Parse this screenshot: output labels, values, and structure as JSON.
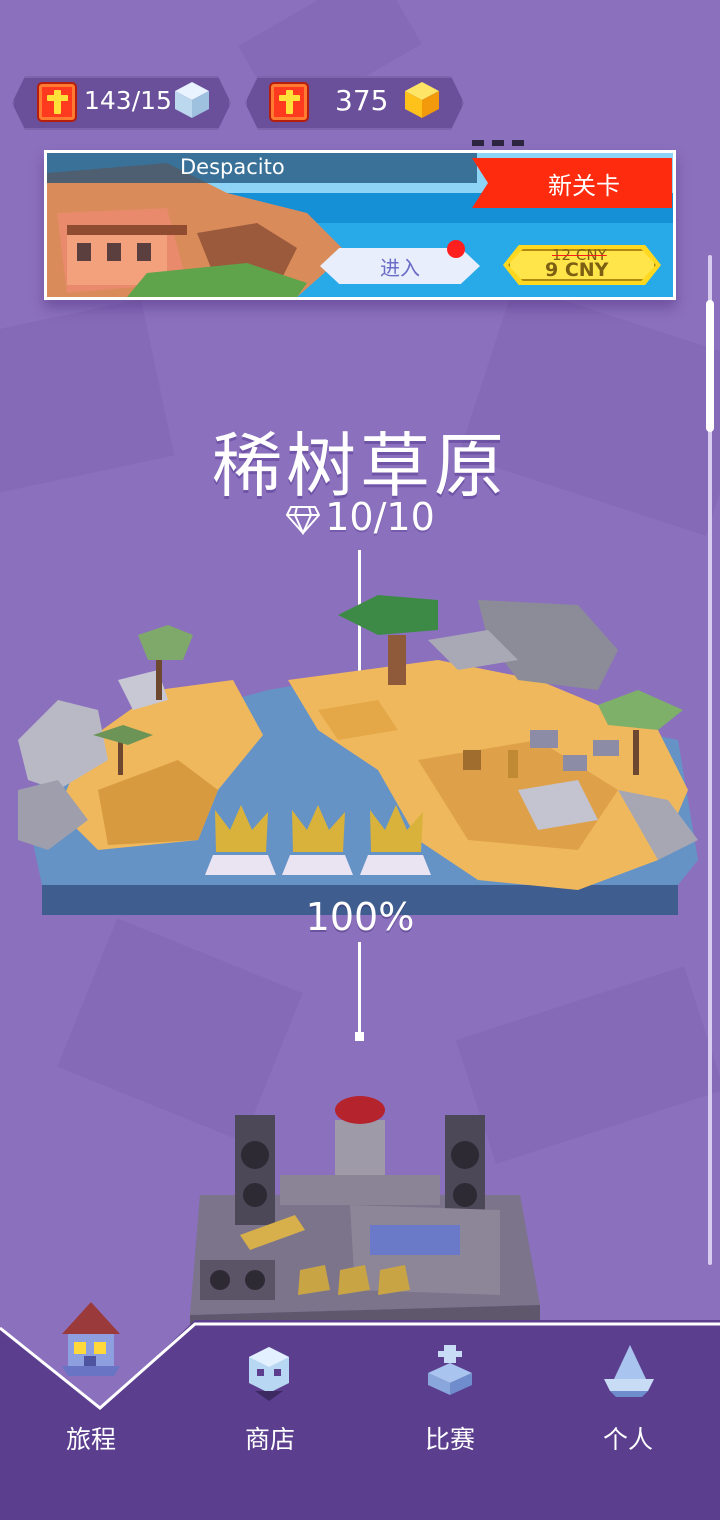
{
  "currency": {
    "lives": "143/15",
    "coins": "375"
  },
  "banner": {
    "song_title": "Despacito",
    "new_level_badge": "新关卡",
    "enter_label": "进入",
    "old_price": "12 CNY",
    "new_price": "9 CNY"
  },
  "level": {
    "title": "稀树草原",
    "gems": "10/10",
    "progress": "100%"
  },
  "nav": {
    "items": [
      {
        "label": "旅程"
      },
      {
        "label": "商店"
      },
      {
        "label": "比赛"
      },
      {
        "label": "个人"
      }
    ]
  },
  "colors": {
    "background": "#8b70bd",
    "nav_bg": "#5b3e8e",
    "accent_red": "#ff2b0f",
    "price_yellow": "#ffd81f"
  }
}
